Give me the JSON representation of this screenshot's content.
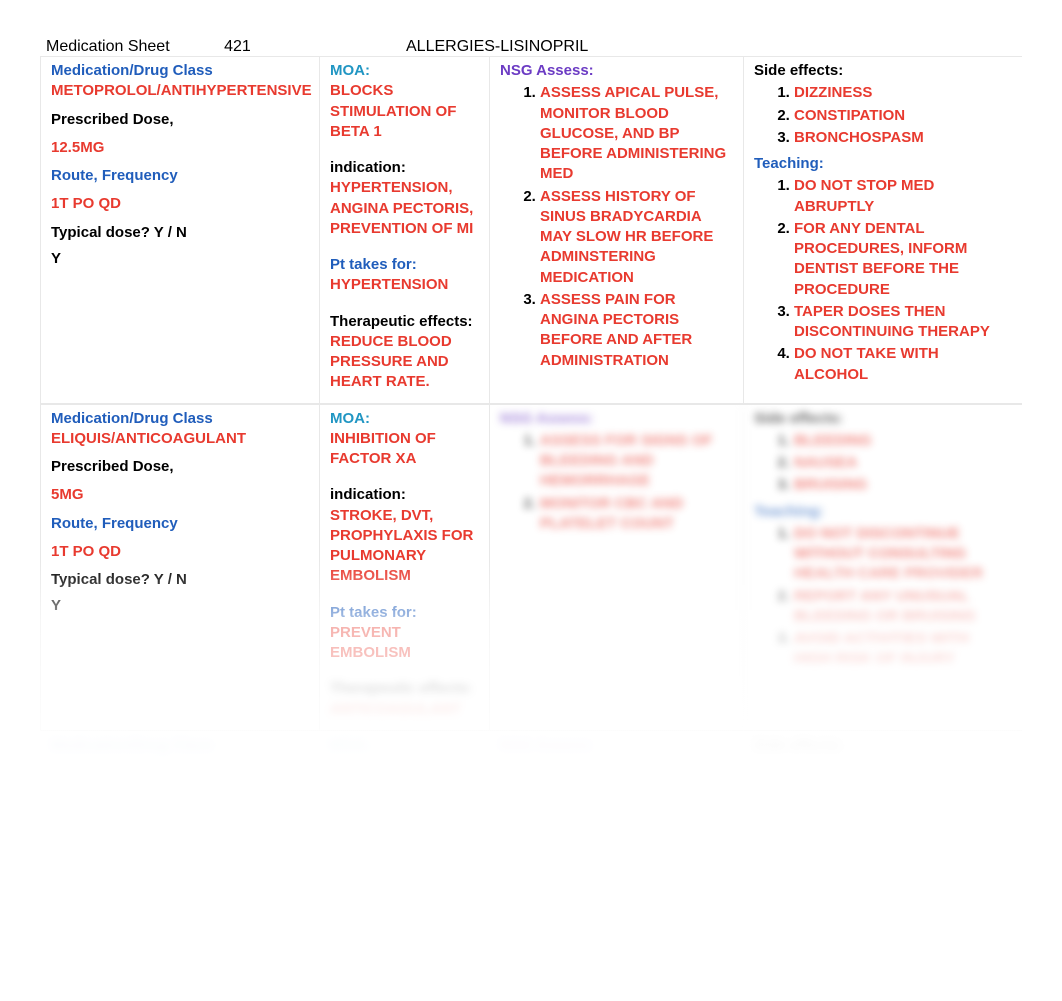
{
  "header": {
    "title": "Medication Sheet",
    "number": "421",
    "allergies": "ALLERGIES-LISINOPRIL"
  },
  "labels": {
    "med_class": "Medication/Drug Class",
    "prescribed": "Prescribed Dose,",
    "route": "Route, Frequency",
    "typical": "Typical dose? Y / N",
    "moa": "MOA:",
    "indication": "indication:",
    "pt_takes": "Pt takes for:",
    "therapeutic": "Therapeutic effects:",
    "nsg": "NSG Assess:",
    "side": "Side effects:",
    "teaching": "Teaching:"
  },
  "rows": [
    {
      "drug": "METOPROLOL/ANTIHYPERTENSIVE",
      "dose": "12.5MG",
      "route": "1T PO QD",
      "typical": "Y",
      "moa": "BLOCKS STIMULATION OF BETA 1",
      "indication": "HYPERTENSION, ANGINA PECTORIS, PREVENTION OF MI",
      "pt_takes": "HYPERTENSION",
      "therapeutic": "REDUCE BLOOD PRESSURE AND HEART RATE.",
      "nsg": [
        "ASSESS APICAL PULSE, MONITOR BLOOD GLUCOSE, AND BP BEFORE ADMINISTERING MED",
        "ASSESS HISTORY OF SINUS BRADYCARDIA MAY SLOW HR BEFORE ADMINSTERING MEDICATION",
        "ASSESS PAIN FOR ANGINA PECTORIS BEFORE AND AFTER ADMINISTRATION"
      ],
      "side": [
        "DIZZINESS",
        "CONSTIPATION",
        "BRONCHOSPASM"
      ],
      "teaching": [
        "DO NOT STOP MED ABRUPTLY",
        "FOR ANY DENTAL PROCEDURES, INFORM DENTIST BEFORE THE PROCEDURE",
        "TAPER DOSES THEN DISCONTINUING THERAPY",
        "DO NOT TAKE WITH ALCOHOL"
      ]
    },
    {
      "drug": "ELIQUIS/ANTICOAGULANT",
      "dose": "5MG",
      "route": "1T PO QD",
      "typical": "Y",
      "moa": "INHIBITION OF FACTOR XA",
      "indication": "STROKE, DVT, PROPHYLAXIS FOR PULMONARY EMBOLISM",
      "pt_takes": "PREVENT EMBOLISM",
      "therapeutic": "ANTICOAGULANT",
      "nsg": [
        "ASSESS FOR SIGNS OF BLEEDING AND HEMORRHAGE",
        "MONITOR CBC AND PLATELET COUNT"
      ],
      "side": [
        "BLEEDING",
        "NAUSEA",
        "BRUISING"
      ],
      "teaching": [
        "DO NOT DISCONTINUE WITHOUT CONSULTING HEALTH CARE PROVIDER",
        "REPORT ANY UNUSUAL BLEEDING OR BRUISING",
        "AVOID ACTIVITIES WITH HIGH RISK OF INJURY"
      ]
    }
  ]
}
